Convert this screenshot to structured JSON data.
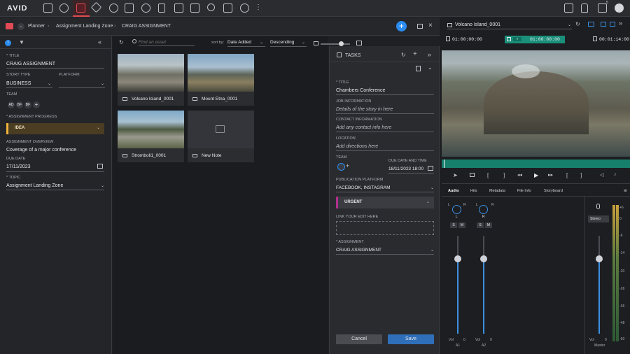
{
  "topbar": {
    "logo": "AVID",
    "notification_count": "5"
  },
  "breadcrumb": {
    "root": "Planner",
    "middle": "Assignment Landing Zone",
    "current": "CRAIG ASSIGNMENT"
  },
  "left": {
    "title_label": "* TITLE",
    "title_value": "CRAIG ASSIGNMENT",
    "story_type_label": "STORY TYPE",
    "story_type_value": "BUSINESS",
    "platform_label": "PLATFORM",
    "platform_value": "",
    "team_label": "TEAM",
    "team_members": [
      "AD",
      "BF",
      "BF"
    ],
    "progress_label": "* ASSIGNMENT PROGRESS",
    "progress_value": "IDEA",
    "overview_label": "ASSIGNMENT OVERVIEW",
    "overview_value": "Coverage of a major conference",
    "due_label": "DUE DATE",
    "due_value": "17/11/2023",
    "topic_label": "* TOPIC",
    "topic_value": "Assignment Landing Zone"
  },
  "search": {
    "placeholder": "Find an asset",
    "sort_label": "sort by:",
    "sort_value": "Date Added",
    "order_value": "Descending"
  },
  "assets": [
    {
      "name": "Volcano Island_0001"
    },
    {
      "name": "Mount Etna_0001"
    },
    {
      "name": "Stromboli1_0001"
    },
    {
      "name": "New Note"
    }
  ],
  "tasks": {
    "header": "TASKS",
    "title_label": "* TITLE",
    "title_value": "Chambers Conference",
    "job_label": "JOB INFORMATION",
    "job_placeholder": "Details of the story in here",
    "contact_label": "CONTACT INFORMATION",
    "contact_placeholder": "Add any contact info here",
    "location_label": "LOCATION",
    "location_placeholder": "Add directions here",
    "team_label": "TEAM",
    "due_label": "DUE DATE AND TIME",
    "due_value": "18/11/2023 18:00",
    "pub_label": "PUBLICATION PLATFORM",
    "pub_value": "FACEBOOK, INSTAGRAM",
    "priority_value": "URGENT",
    "link_label": "LINK YOUR EDIT HERE",
    "assignment_label": "* ASSIGNMENT",
    "assignment_value": "CRAIG ASSIGNMENT",
    "cancel": "Cancel",
    "save": "Save"
  },
  "viewer": {
    "clip_name": "Volcano Island_0001",
    "tc_in": "01:00:00:00",
    "tc_current": "01:00:00:00",
    "tc_duration": "00:01:14:00",
    "tabs": [
      "Audio",
      "Hits",
      "Metadata",
      "File Info",
      "Storyboard"
    ]
  },
  "mixer": {
    "channels": [
      {
        "name": "A1",
        "vol": "Vol",
        "val": "0",
        "pan": "L"
      },
      {
        "name": "A2",
        "vol": "Vol",
        "val": "0",
        "pan": "R"
      }
    ],
    "master": {
      "name": "Master",
      "vol": "Vol",
      "val": "0",
      "mode": "Stereo"
    },
    "scale": [
      "+6",
      "0",
      "-6",
      "-14",
      "-20",
      "-26",
      "-36",
      "-48",
      "-60"
    ],
    "solo": "S",
    "mute": "M"
  },
  "colors": {
    "accent": "#2a8cf0",
    "red": "#e24b55",
    "idea": "#f0b13d",
    "urgent": "#b1308c",
    "save": "#2f6fba",
    "timeline": "#1a8f7a"
  }
}
